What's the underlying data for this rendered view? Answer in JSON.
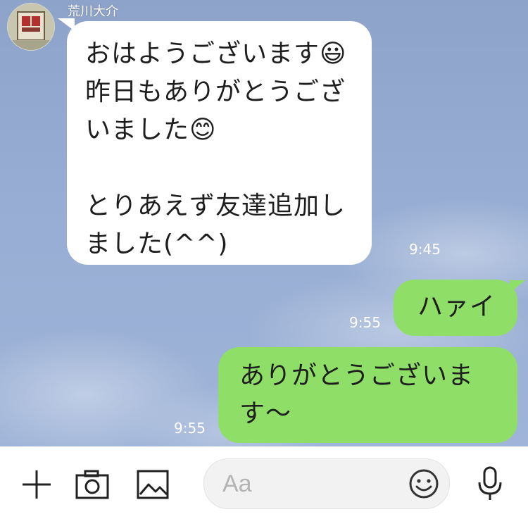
{
  "sender": {
    "name": "荒川大介"
  },
  "messages": [
    {
      "direction": "incoming",
      "text": "おはようございます😃\n昨日もありがとうござ\nいました😊\n\nとりあえず友達追加し\nました(^^)",
      "time": "9:45"
    },
    {
      "direction": "outgoing",
      "text": "ハァイ",
      "time": "9:55"
    },
    {
      "direction": "outgoing",
      "text": "ありがとうございま\nす〜",
      "time": "9:55"
    }
  ],
  "input": {
    "placeholder": "Aa"
  },
  "toolbar": {
    "icons": [
      "plus-icon",
      "camera-icon",
      "image-icon",
      "emoji-icon",
      "microphone-icon"
    ]
  },
  "colors": {
    "incoming_bubble": "#ffffff",
    "outgoing_bubble": "#8ede68",
    "chat_background": "#97add3"
  }
}
